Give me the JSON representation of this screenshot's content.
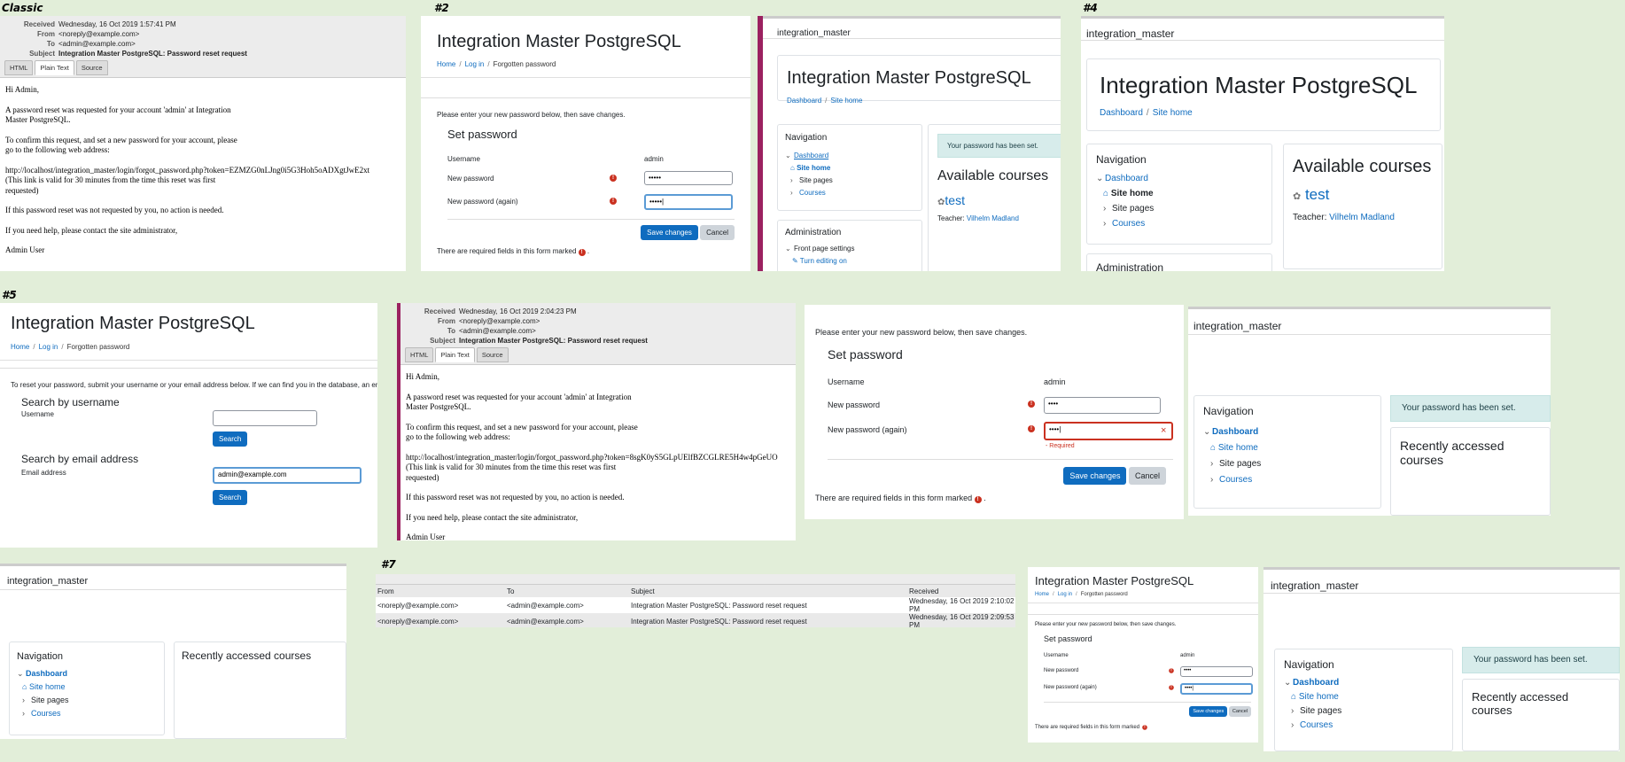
{
  "labels": {
    "classic": "Classic",
    "p2": "#2",
    "p4": "#4",
    "p5": "#5",
    "p7": "#7"
  },
  "email1": {
    "received_k": "Received",
    "received": "Wednesday, 16 Oct 2019 1:57:41 PM",
    "from_k": "From",
    "from": "<noreply@example.com>",
    "to_k": "To",
    "to": "<admin@example.com>",
    "subject_k": "Subject",
    "subject": "Integration Master PostgreSQL: Password reset request",
    "tabs": [
      "HTML",
      "Plain Text",
      "Source"
    ],
    "greeting": "Hi Admin,",
    "p1": "A password reset was requested for your account 'admin' at Integration\nMaster PostgreSQL.",
    "p2": "To confirm this request, and set a new password for your account, please\ngo to the following web address:",
    "p3": "http://localhost/integration_master/login/forgot_password.php?token=EZMZG0nLJng0i5G3Hoh5oADXgtJwE2xt\n(This link is valid for 30 minutes from the time this reset was first\nrequested)",
    "p4": "If this password reset was not requested by you, no action is needed.",
    "p5": "If you need help, please contact the site administrator,",
    "sig": "Admin User"
  },
  "email2": {
    "received_k": "Received",
    "received": "Wednesday, 16 Oct 2019 2:04:23 PM",
    "from_k": "From",
    "from": "<noreply@example.com>",
    "to_k": "To",
    "to": "<admin@example.com>",
    "subject_k": "Subject",
    "subject": "Integration Master PostgreSQL: Password reset request",
    "tabs": [
      "HTML",
      "Plain Text",
      "Source"
    ],
    "greeting": "Hi Admin,",
    "p1": "A password reset was requested for your account 'admin' at Integration\nMaster PostgreSQL.",
    "p2": "To confirm this request, and set a new password for your account, please\ngo to the following web address:",
    "p3": "http://localhost/integration_master/login/forgot_password.php?token=8sgK0yS5GLpUElfBZCGLRE5H4w4pGeUO\n(This link is valid for 30 minutes from the time this reset was first\nrequested)",
    "p4": "If this password reset was not requested by you, no action is needed.",
    "p5": "If you need help, please contact the site administrator,",
    "sig": "Admin User"
  },
  "site": {
    "title": "Integration Master PostgreSQL",
    "short": "integration_master",
    "home": "Home",
    "login": "Log in",
    "forgotten": "Forgotten password",
    "dashboard": "Dashboard",
    "sitehome": "Site home"
  },
  "setpw": {
    "intro": "Please enter your new password below, then save changes.",
    "heading": "Set password",
    "username_label": "Username",
    "username": "admin",
    "newpw_label": "New password",
    "newpw_again_label": "New password (again)",
    "pw1": "•••••",
    "pw2": "•••••|",
    "pw_short": "••••",
    "pw_short2": "••••|",
    "required": "- Required",
    "save": "Save changes",
    "cancel": "Cancel",
    "footer": "There are required fields in this form marked"
  },
  "nav": {
    "heading": "Navigation",
    "dashboard": "Dashboard",
    "sitehome": "Site home",
    "sitepages": "Site pages",
    "courses": "Courses",
    "admin": "Administration",
    "frontpage": "Front page settings",
    "editing": "Turn editing on"
  },
  "main": {
    "pwset": "Your password has been set.",
    "available": "Available courses",
    "course": "test",
    "teacher_label": "Teacher:",
    "teacher": "Vilhelm Madland",
    "recent": "Recently accessed courses"
  },
  "forgot": {
    "intro": "To reset your password, submit your username or your email address below. If we can find you in the database, an em",
    "by_user": "Search by username",
    "username_label": "Username",
    "search": "Search",
    "by_email": "Search by email address",
    "email_label": "Email address",
    "email_value": "admin@example.com"
  },
  "mailbox": {
    "columns": [
      "From",
      "To",
      "Subject",
      "Received"
    ],
    "rows": [
      [
        "<noreply@example.com>",
        "<admin@example.com>",
        "Integration Master PostgreSQL: Password reset request",
        "Wednesday, 16 Oct 2019 2:10:02 PM"
      ],
      [
        "<noreply@example.com>",
        "<admin@example.com>",
        "Integration Master PostgreSQL: Password reset request",
        "Wednesday, 16 Oct 2019 2:09:53 PM"
      ]
    ]
  }
}
